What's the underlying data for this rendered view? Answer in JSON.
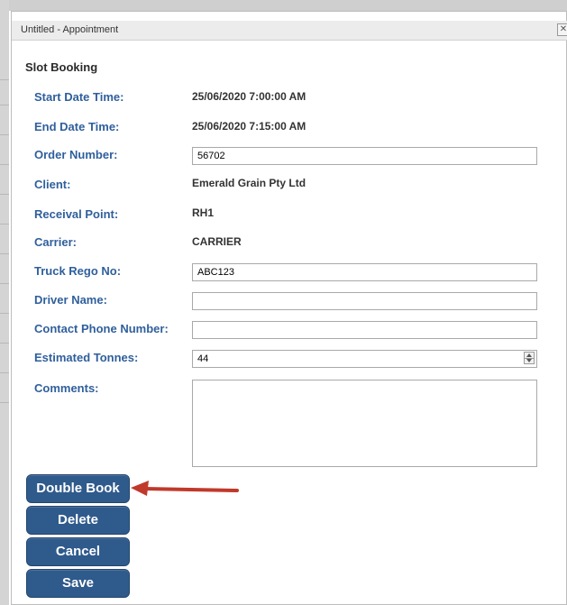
{
  "window": {
    "title": "Untitled - Appointment",
    "close_glyph": "✕"
  },
  "form": {
    "section_title": "Slot Booking",
    "fields": {
      "start_date_time": {
        "label": "Start Date Time:",
        "value": "25/06/2020 7:00:00 AM"
      },
      "end_date_time": {
        "label": "End Date Time:",
        "value": "25/06/2020 7:15:00 AM"
      },
      "order_number": {
        "label": "Order Number:",
        "value": "56702",
        "placeholder": ""
      },
      "client": {
        "label": "Client:",
        "value": "Emerald Grain Pty Ltd"
      },
      "receival_point": {
        "label": "Receival Point:",
        "value": "RH1"
      },
      "carrier": {
        "label": "Carrier:",
        "value": "CARRIER"
      },
      "truck_rego_no": {
        "label": "Truck Rego No:",
        "value": "ABC123",
        "placeholder": ""
      },
      "driver_name": {
        "label": "Driver Name:",
        "value": "",
        "placeholder": ""
      },
      "contact_phone_number": {
        "label": "Contact Phone Number:",
        "value": "",
        "placeholder": ""
      },
      "estimated_tonnes": {
        "label": "Estimated Tonnes:",
        "value": "44",
        "placeholder": ""
      },
      "comments": {
        "label": "Comments:",
        "value": "",
        "placeholder": ""
      }
    }
  },
  "buttons": {
    "double_book": "Double Book",
    "delete": "Delete",
    "cancel": "Cancel",
    "save": "Save"
  },
  "colors": {
    "label_blue": "#2f5f9c",
    "button_blue": "#2f5a8c",
    "annotation_arrow": "#c0392b"
  }
}
